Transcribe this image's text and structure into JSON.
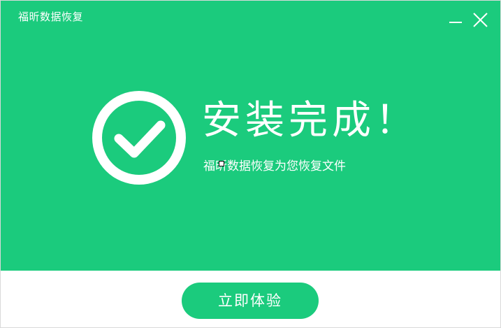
{
  "window": {
    "title": "福昕数据恢复"
  },
  "main": {
    "headline": "安装完成！",
    "subline": "福昕数据恢复为您恢复文件"
  },
  "footer": {
    "cta_label": "立即体验"
  },
  "icons": {
    "success": "check-circle-icon",
    "minimize": "minimize-icon",
    "close": "close-icon"
  },
  "colors": {
    "brand": "#1bcb7d",
    "text_on_brand": "#ffffff"
  }
}
